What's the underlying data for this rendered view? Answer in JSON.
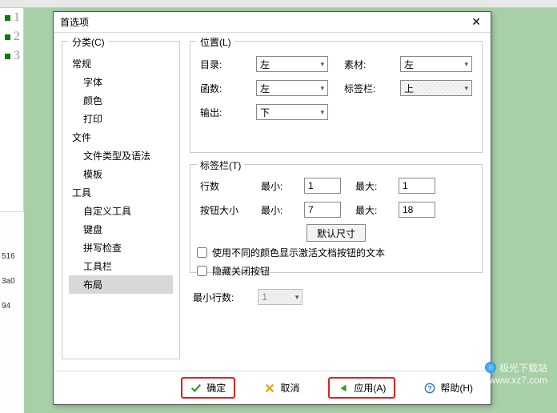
{
  "dialog": {
    "title": "首选项"
  },
  "category": {
    "legend": "分类(C)",
    "items": [
      {
        "label": "常规",
        "level": 0
      },
      {
        "label": "字体",
        "level": 1
      },
      {
        "label": "颜色",
        "level": 1
      },
      {
        "label": "打印",
        "level": 1
      },
      {
        "label": "文件",
        "level": 0
      },
      {
        "label": "文件类型及语法",
        "level": 1
      },
      {
        "label": "模板",
        "level": 1
      },
      {
        "label": "工具",
        "level": 0
      },
      {
        "label": "自定义工具",
        "level": 1
      },
      {
        "label": "键盘",
        "level": 1
      },
      {
        "label": "拼写检查",
        "level": 1
      },
      {
        "label": "工具栏",
        "level": 1
      },
      {
        "label": "布局",
        "level": 1,
        "selected": true
      }
    ]
  },
  "position": {
    "legend": "位置(L)",
    "labels": {
      "catalog": "目录:",
      "material": "素材:",
      "function": "函数:",
      "tabbar": "标签栏:",
      "output": "输出:"
    },
    "values": {
      "catalog": "左",
      "material": "左",
      "function": "左",
      "tabbar": "上",
      "output": "下"
    }
  },
  "tabbar": {
    "legend": "标签栏(T)",
    "labels": {
      "rows": "行数",
      "btnsize": "按钮大小",
      "min": "最小:",
      "max": "最大:",
      "default": "默认尺寸"
    },
    "values": {
      "rows_min": "1",
      "rows_max": "1",
      "btn_min": "7",
      "btn_max": "18"
    },
    "checks": {
      "diffcolor": "使用不同的颜色显示激活文档按钮的文本",
      "hideclose": "隐藏关闭按钮"
    }
  },
  "minrows": {
    "label": "最小行数:",
    "value": "1"
  },
  "buttons": {
    "ok": "确定",
    "cancel": "取消",
    "apply": "应用(A)",
    "help": "帮助(H)"
  },
  "gutter": {
    "lines": [
      "1",
      "2",
      "3"
    ]
  },
  "leftpanel": {
    "rows": [
      "516",
      "3a0",
      "94"
    ]
  },
  "watermark": {
    "line1": "极光下载站",
    "line2": "www.xz7.com"
  }
}
